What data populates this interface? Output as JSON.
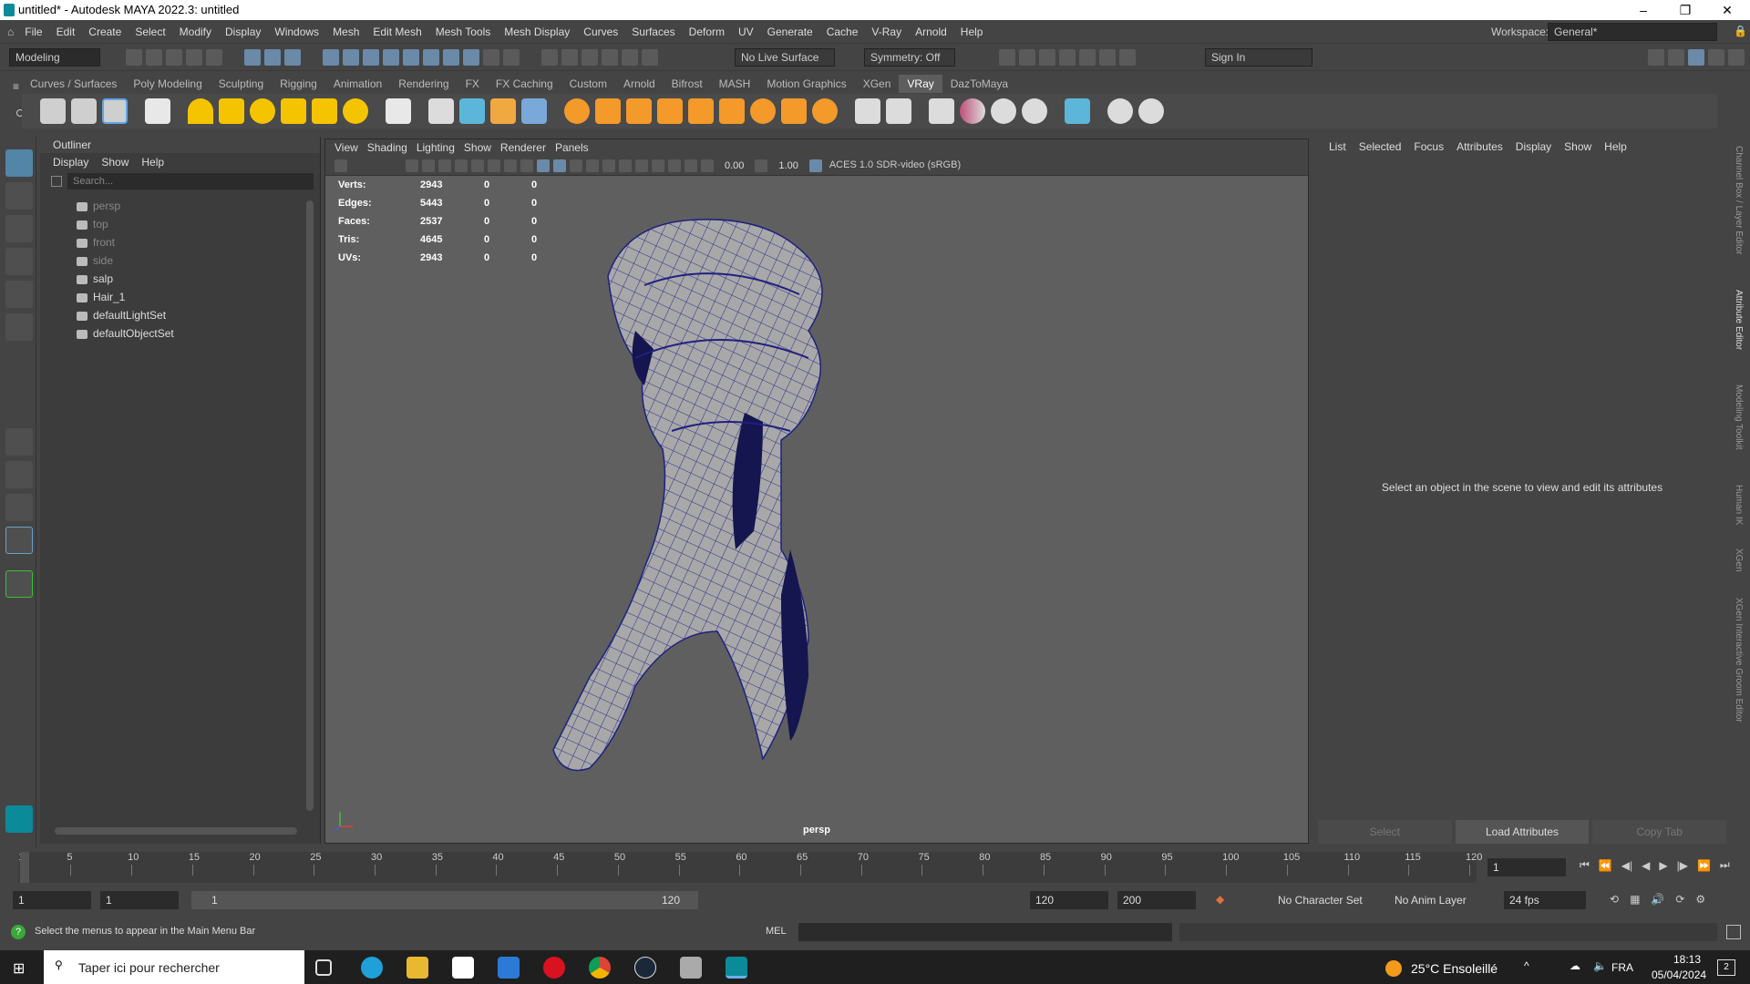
{
  "title_bar": {
    "title": "untitled* - Autodesk MAYA 2022.3: untitled"
  },
  "menubar": {
    "items": [
      "File",
      "Edit",
      "Create",
      "Select",
      "Modify",
      "Display",
      "Windows",
      "Mesh",
      "Edit Mesh",
      "Mesh Tools",
      "Mesh Display",
      "Curves",
      "Surfaces",
      "Deform",
      "UV",
      "Generate",
      "Cache",
      "V-Ray",
      "Arnold",
      "Help"
    ],
    "workspace_label": "Workspace:",
    "workspace_value": "General*"
  },
  "statusline": {
    "mode": "Modeling",
    "live_surface": "No Live Surface",
    "symmetry": "Symmetry: Off",
    "sign_in": "Sign In"
  },
  "shelf_tabs": [
    "Curves / Surfaces",
    "Poly Modeling",
    "Sculpting",
    "Rigging",
    "Animation",
    "Rendering",
    "FX",
    "FX Caching",
    "Custom",
    "Arnold",
    "Bifrost",
    "MASH",
    "Motion Graphics",
    "XGen",
    "VRay",
    "DazToMaya"
  ],
  "shelf_active": "VRay",
  "outliner": {
    "title": "Outliner",
    "menu": [
      "Display",
      "Show",
      "Help"
    ],
    "search_placeholder": "Search...",
    "items": [
      {
        "label": "persp",
        "dim": true
      },
      {
        "label": "top",
        "dim": true
      },
      {
        "label": "front",
        "dim": true
      },
      {
        "label": "side",
        "dim": true
      },
      {
        "label": "salp",
        "dim": false
      },
      {
        "label": "Hair_1",
        "dim": false
      },
      {
        "label": "defaultLightSet",
        "dim": false
      },
      {
        "label": "defaultObjectSet",
        "dim": false
      }
    ]
  },
  "viewport": {
    "menu": [
      "View",
      "Shading",
      "Lighting",
      "Show",
      "Renderer",
      "Panels"
    ],
    "exposure": "0.00",
    "gamma": "1.00",
    "color_space": "ACES 1.0 SDR-video (sRGB)",
    "camera_label": "persp",
    "hud": [
      {
        "label": "Verts:",
        "v1": "2943",
        "v2": "0",
        "v3": "0"
      },
      {
        "label": "Edges:",
        "v1": "5443",
        "v2": "0",
        "v3": "0"
      },
      {
        "label": "Faces:",
        "v1": "2537",
        "v2": "0",
        "v3": "0"
      },
      {
        "label": "Tris:",
        "v1": "4645",
        "v2": "0",
        "v3": "0"
      },
      {
        "label": "UVs:",
        "v1": "2943",
        "v2": "0",
        "v3": "0"
      }
    ]
  },
  "attribute_editor": {
    "menu": [
      "List",
      "Selected",
      "Focus",
      "Attributes",
      "Display",
      "Show",
      "Help"
    ],
    "message": "Select an object in the scene to view and edit its attributes",
    "buttons": [
      "Select",
      "Load Attributes",
      "Copy Tab"
    ]
  },
  "side_tabs": [
    "Channel Box / Layer Editor",
    "Attribute Editor",
    "Modeling Toolkit",
    "Human IK",
    "XGen",
    "XGen Interactive Groom Editor"
  ],
  "timeline": {
    "ticks": [
      "1",
      "5",
      "10",
      "15",
      "20",
      "25",
      "30",
      "35",
      "40",
      "45",
      "50",
      "55",
      "60",
      "65",
      "70",
      "75",
      "80",
      "85",
      "90",
      "95",
      "100",
      "105",
      "110",
      "115",
      "120"
    ],
    "current_frame": "1"
  },
  "range": {
    "start": "1",
    "anim_start": "1",
    "slider_start": "1",
    "slider_end": "120",
    "end": "120",
    "anim_end": "200",
    "character_set": "No Character Set",
    "anim_layer": "No Anim Layer",
    "fps": "24 fps"
  },
  "command_line": {
    "help": "Select the menus to appear in the Main Menu Bar",
    "mel": "MEL"
  },
  "taskbar": {
    "search": "Taper ici pour rechercher",
    "weather": "25°C  Ensoleillé",
    "lang": "FRA",
    "time": "18:13",
    "date": "05/04/2024",
    "notif": "2"
  }
}
